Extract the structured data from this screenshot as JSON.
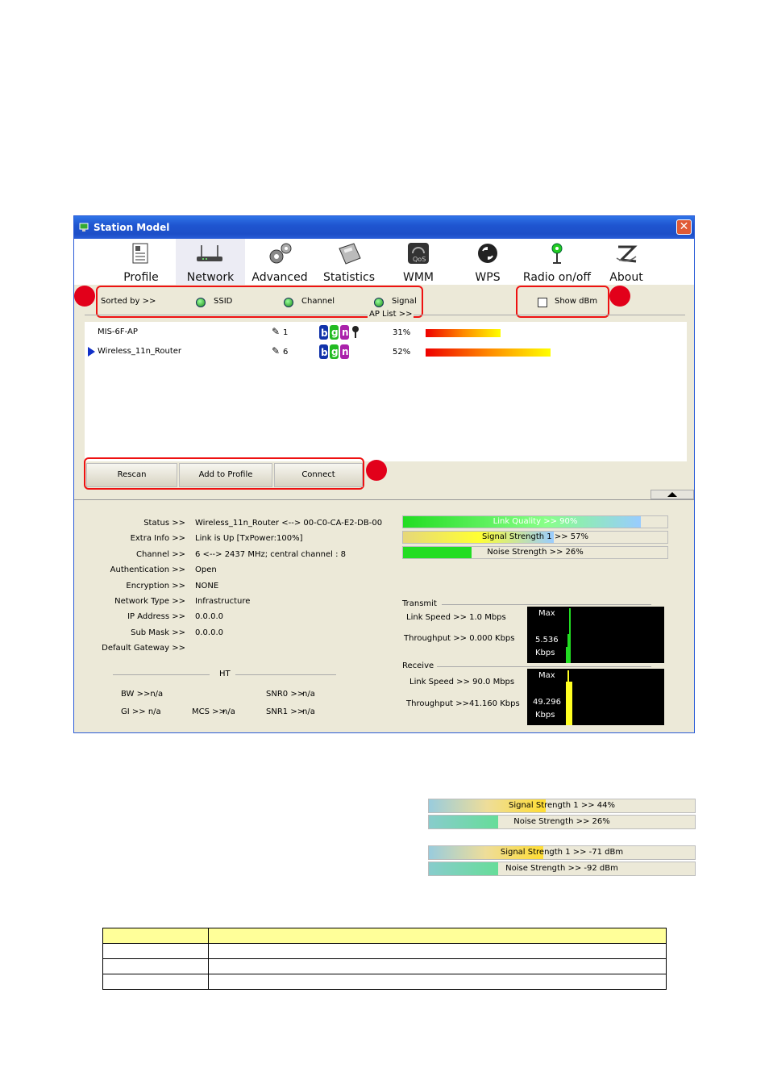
{
  "window": {
    "title": "Station Model"
  },
  "toolbar": {
    "items": [
      "Profile",
      "Network",
      "Advanced",
      "Statistics",
      "WMM",
      "WPS",
      "Radio on/off",
      "About"
    ],
    "selected": "Network"
  },
  "sort": {
    "label": "Sorted by >>",
    "ssid": "SSID",
    "channel": "Channel",
    "signal": "Signal",
    "show_dbm": "Show dBm",
    "ap_list": "AP List >>"
  },
  "aps": [
    {
      "ssid": "MIS-6F-AP",
      "channel": "1",
      "signal": "31%",
      "signal_value": 31,
      "bar": 0.3,
      "selected": false
    },
    {
      "ssid": "Wireless_11n_Router",
      "channel": "6",
      "signal": "52%",
      "signal_value": 52,
      "bar": 0.5,
      "selected": true
    }
  ],
  "buttons": {
    "rescan": "Rescan",
    "add": "Add to Profile",
    "connect": "Connect"
  },
  "info": [
    {
      "k": "Status >>",
      "v": "Wireless_11n_Router <--> 00-C0-CA-E2-DB-00"
    },
    {
      "k": "Extra Info >>",
      "v": "Link is Up [TxPower:100%]"
    },
    {
      "k": "Channel >>",
      "v": "6 <--> 2437 MHz; central channel : 8"
    },
    {
      "k": "Authentication >>",
      "v": "Open"
    },
    {
      "k": "Encryption >>",
      "v": "NONE"
    },
    {
      "k": "Network Type >>",
      "v": "Infrastructure"
    },
    {
      "k": "IP Address >>",
      "v": "0.0.0.0"
    },
    {
      "k": "Sub Mask >>",
      "v": "0.0.0.0"
    },
    {
      "k": "Default Gateway >>",
      "v": ""
    }
  ],
  "ht": {
    "title": "HT",
    "bw": "BW >>n/a",
    "gi": "GI >> n/a",
    "mcs": "MCS >>",
    "mcs_v": "n/a",
    "snr0": "SNR0 >>",
    "snr0_v": "n/a",
    "snr1": "SNR1 >>",
    "snr1_v": "n/a"
  },
  "quality": [
    {
      "text": "Link Quality >> 90%",
      "value": 90
    },
    {
      "text": "Signal Strength 1 >> 57%",
      "value": 57
    },
    {
      "text": "Noise Strength >> 26%",
      "value": 26
    }
  ],
  "transmit": {
    "title": "Transmit",
    "speed": "Link Speed >>  1.0 Mbps",
    "throughput": "Throughput >> 0.000 Kbps",
    "max": "Max",
    "val": "5.536",
    "unit": "Kbps"
  },
  "receive": {
    "title": "Receive",
    "speed": "Link Speed >> 90.0 Mbps",
    "throughput": "Throughput >>41.160 Kbps",
    "max": "Max",
    "val": "49.296",
    "unit": "Kbps"
  },
  "extra_bars": [
    {
      "text": "Signal Strength 1 >> 44%",
      "value": 44
    },
    {
      "text": "Noise Strength >> 26%",
      "value": 26
    },
    {
      "text": "Signal Strength 1 >> -71 dBm",
      "value": 43
    },
    {
      "text": "Noise Strength >> -92 dBm",
      "value": 26
    }
  ],
  "colors": {
    "title_blue": "#1f55d0",
    "highlight_red": "#e2001a",
    "table_header": "#ffff99"
  }
}
